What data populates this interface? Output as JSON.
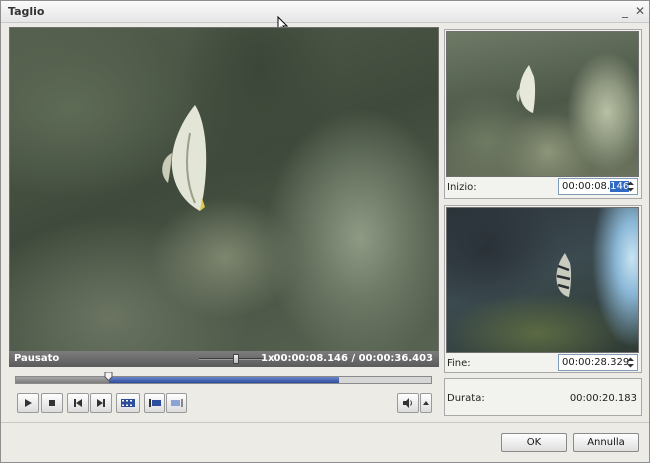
{
  "window": {
    "title": "Taglio"
  },
  "player": {
    "status": "Pausato",
    "speed": "1x",
    "current_time": "00:00:08.146",
    "time_separator": "/",
    "total_time": "00:00:36.403",
    "progress_fraction": 0.224,
    "selection_start_fraction": 0.224,
    "selection_end_fraction": 0.778,
    "speed_slider_fraction": 0.62
  },
  "transport": {
    "play_icon": "play-icon",
    "stop_icon": "stop-icon",
    "prev_frame_icon": "skip-back-icon",
    "next_frame_icon": "skip-forward-icon",
    "cut_icon": "film-cut-icon",
    "mark_start_icon": "mark-start-icon",
    "mark_end_icon": "mark-end-icon",
    "volume_icon": "speaker-icon"
  },
  "start_panel": {
    "label": "Inizio:",
    "value_prefix": "00:00:08.",
    "value_selected": "146"
  },
  "end_panel": {
    "label": "Fine:",
    "value": "00:00:28.329"
  },
  "duration_panel": {
    "label": "Durata:",
    "value": "00:00:20.183"
  },
  "buttons": {
    "ok": "OK",
    "cancel": "Annulla"
  },
  "colors": {
    "selection": "#2c4c9e",
    "text_highlight": "#316ac5"
  }
}
